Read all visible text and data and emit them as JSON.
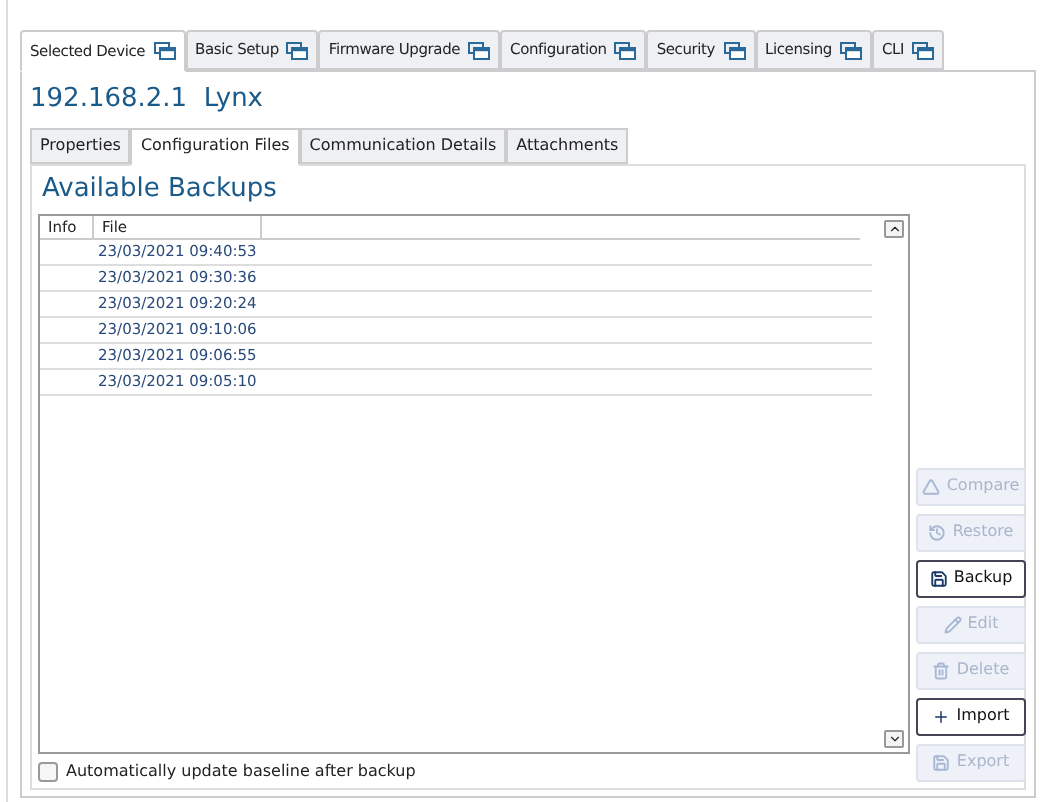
{
  "main_tabs": [
    {
      "label": "Selected Device",
      "selected": true
    },
    {
      "label": "Basic Setup",
      "selected": false
    },
    {
      "label": "Firmware Upgrade",
      "selected": false
    },
    {
      "label": "Configuration",
      "selected": false
    },
    {
      "label": "Security",
      "selected": false
    },
    {
      "label": "Licensing",
      "selected": false
    },
    {
      "label": "CLI",
      "selected": false
    }
  ],
  "device_title": "192.168.2.1  Lynx",
  "sub_tabs": [
    {
      "label": "Properties",
      "selected": false
    },
    {
      "label": "Configuration Files",
      "selected": true
    },
    {
      "label": "Communication Details",
      "selected": false
    },
    {
      "label": "Attachments",
      "selected": false
    }
  ],
  "section_title": "Available Backups",
  "table": {
    "columns": [
      "Info",
      "File"
    ],
    "rows": [
      [
        "",
        "23/03/2021 09:40:53"
      ],
      [
        "",
        "23/03/2021 09:30:36"
      ],
      [
        "",
        "23/03/2021 09:20:24"
      ],
      [
        "",
        "23/03/2021 09:10:06"
      ],
      [
        "",
        "23/03/2021 09:06:55"
      ],
      [
        "",
        "23/03/2021 09:05:10"
      ]
    ]
  },
  "actions": [
    {
      "kind": "compare",
      "label": "Compare",
      "disabled": true
    },
    {
      "kind": "restore",
      "label": "Restore",
      "disabled": true
    },
    {
      "kind": "backup",
      "label": "Backup",
      "disabled": false
    },
    {
      "kind": "edit",
      "label": "Edit",
      "disabled": true
    },
    {
      "kind": "delete",
      "label": "Delete",
      "disabled": true
    },
    {
      "kind": "import",
      "label": "Import",
      "disabled": false
    },
    {
      "kind": "export",
      "label": "Export",
      "disabled": true
    }
  ],
  "auto_update": {
    "label": "Automatically update baseline after backup",
    "checked": false
  }
}
